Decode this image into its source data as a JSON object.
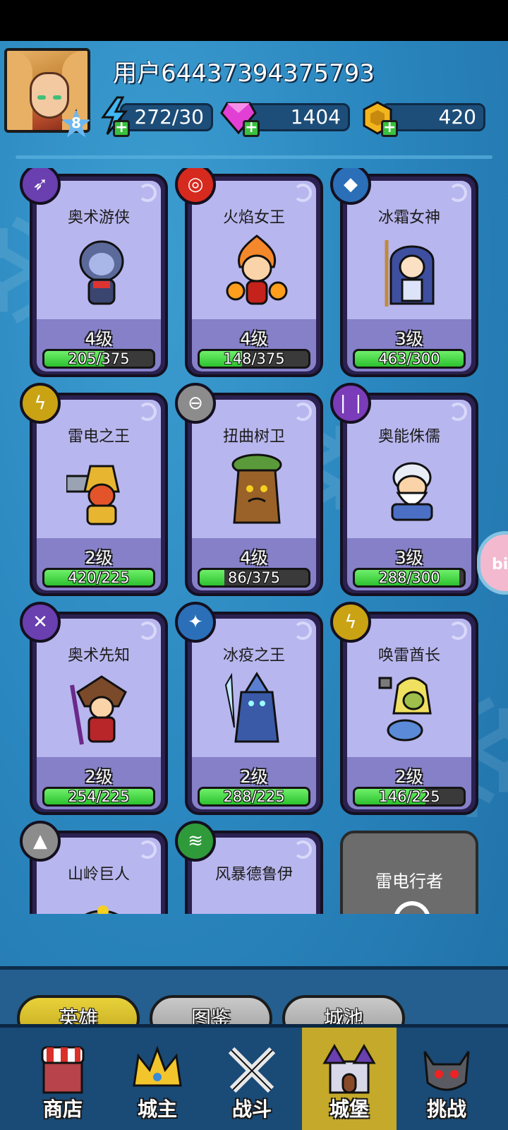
{
  "user": {
    "name": "用户64437394375793",
    "level": "8"
  },
  "resources": {
    "energy": "272/30",
    "gems": "1404",
    "gold": "420"
  },
  "heroes": [
    {
      "name": "奥术游侠",
      "level": "4级",
      "xp": "205/375",
      "progress": 0.55,
      "badge_color": "#6a3fb0",
      "badge_icon": "arrows-icon"
    },
    {
      "name": "火焰女王",
      "level": "4级",
      "xp": "148/375",
      "progress": 0.39,
      "badge_color": "#d62a1e",
      "badge_icon": "fire-ring-icon"
    },
    {
      "name": "冰霜女神",
      "level": "3级",
      "xp": "463/300",
      "progress": 1.0,
      "badge_color": "#2a6fb8",
      "badge_icon": "ice-crystal-icon"
    },
    {
      "name": "雷电之王",
      "level": "2级",
      "xp": "420/225",
      "progress": 1.0,
      "badge_color": "#c9a313",
      "badge_icon": "lightning-icon"
    },
    {
      "name": "扭曲树卫",
      "level": "4级",
      "xp": "86/375",
      "progress": 0.23,
      "badge_color": "#8c8c8c",
      "badge_icon": "shield-icon"
    },
    {
      "name": "奥能侏儒",
      "level": "3级",
      "xp": "288/300",
      "progress": 0.96,
      "badge_color": "#7a3cb8",
      "badge_icon": "arcane-beam-icon"
    },
    {
      "name": "奥术先知",
      "level": "2级",
      "xp": "254/225",
      "progress": 1.0,
      "badge_color": "#6a3fb0",
      "badge_icon": "crossed-arrows-icon"
    },
    {
      "name": "冰疫之王",
      "level": "2级",
      "xp": "288/225",
      "progress": 1.0,
      "badge_color": "#2a6fb8",
      "badge_icon": "ice-shard-icon"
    },
    {
      "name": "唤雷酋长",
      "level": "2级",
      "xp": "146/225",
      "progress": 0.65,
      "badge_color": "#c9a313",
      "badge_icon": "thunder-icon"
    },
    {
      "name": "山岭巨人",
      "level": "",
      "xp": "",
      "progress": 0,
      "badge_color": "#8c8c8c",
      "badge_icon": "rock-icon"
    },
    {
      "name": "风暴德鲁伊",
      "level": "",
      "xp": "",
      "progress": 0,
      "badge_color": "#2f9a3a",
      "badge_icon": "tornado-icon"
    }
  ],
  "locked_hero": {
    "name": "雷电行者"
  },
  "tabs": [
    {
      "label": "英雄",
      "active": true
    },
    {
      "label": "图鉴",
      "active": false
    },
    {
      "label": "城池",
      "active": false
    }
  ],
  "nav": [
    {
      "label": "商店",
      "icon": "shop-icon",
      "active": false
    },
    {
      "label": "城主",
      "icon": "crown-icon",
      "active": false
    },
    {
      "label": "战斗",
      "icon": "crossed-swords-icon",
      "active": false
    },
    {
      "label": "城堡",
      "icon": "castle-icon",
      "active": true
    },
    {
      "label": "挑战",
      "icon": "demon-helmet-icon",
      "active": false
    }
  ],
  "floating_button": {
    "label": "bili"
  }
}
